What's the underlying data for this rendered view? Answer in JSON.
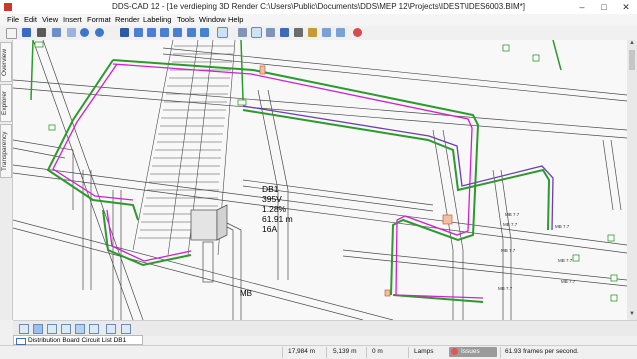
{
  "window": {
    "title": "DDS-CAD 12 - [1e verdieping  3D  Render  C:\\Users\\Public\\Documents\\DDS\\MEP 12\\Projects\\IDEST\\IDES6003.BIM*]",
    "minimize": "–",
    "maximize": "□",
    "close": "✕"
  },
  "menu": [
    "File",
    "Edit",
    "View",
    "Insert",
    "Format",
    "Render",
    "Labeling",
    "Tools",
    "Window",
    "Help"
  ],
  "side_tabs": [
    "Overview",
    "Explorer",
    "Transparency"
  ],
  "viewport": {
    "annotation": [
      "DB1",
      "395V",
      "1.28%",
      "61.91 m",
      "16A"
    ],
    "mb_label": "MB",
    "small_labels": [
      "MB 7.7",
      "MB 7.7",
      "MB 7.7",
      "MB 7.7",
      "MB 7.7",
      "MB 7.7",
      "MB 7.7"
    ]
  },
  "bottom_list_tab": "Distribution Board Circuit List DB1",
  "status": {
    "x": "17,984 m",
    "y": "5,139 m",
    "z": "0 m",
    "mode": "Lamps",
    "issues": "Issues",
    "fps": "61.93 frames per second."
  },
  "colors": {
    "cable_tray": "#2c9a2c",
    "cable_magenta": "#d020d0",
    "cable_purple": "#6a3fb0",
    "structure": "#4a4a4a"
  }
}
